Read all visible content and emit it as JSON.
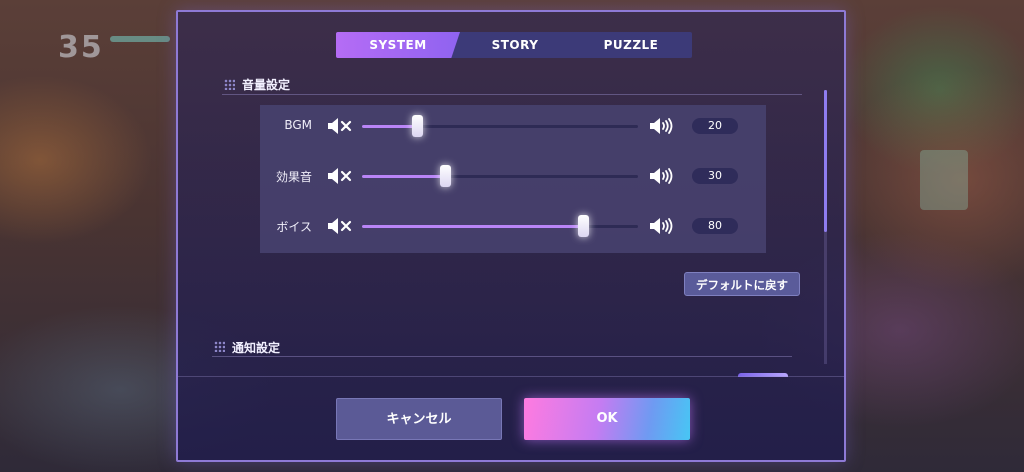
{
  "background": {
    "hud_number": "35"
  },
  "tabs": [
    {
      "label": "SYSTEM",
      "active": true
    },
    {
      "label": "STORY",
      "active": false
    },
    {
      "label": "PUZZLE",
      "active": false
    }
  ],
  "sections": {
    "volume": {
      "title": "音量設定"
    },
    "notification": {
      "title": "通知設定"
    }
  },
  "volume": [
    {
      "label": "BGM",
      "value": "20",
      "level": 20
    },
    {
      "label": "効果音",
      "value": "30",
      "level": 30
    },
    {
      "label": "ボイス",
      "value": "80",
      "level": 80
    }
  ],
  "reset_button": "デフォルトに戻す",
  "footer": {
    "cancel_label": "キャンセル",
    "ok_label": "OK"
  },
  "colors": {
    "accent": "#b985f7",
    "tab_active": "#a368f3",
    "dialog_border": "#8e7ad6"
  },
  "icons": [
    "grid-icon",
    "mute-speaker-icon",
    "loud-speaker-icon"
  ]
}
